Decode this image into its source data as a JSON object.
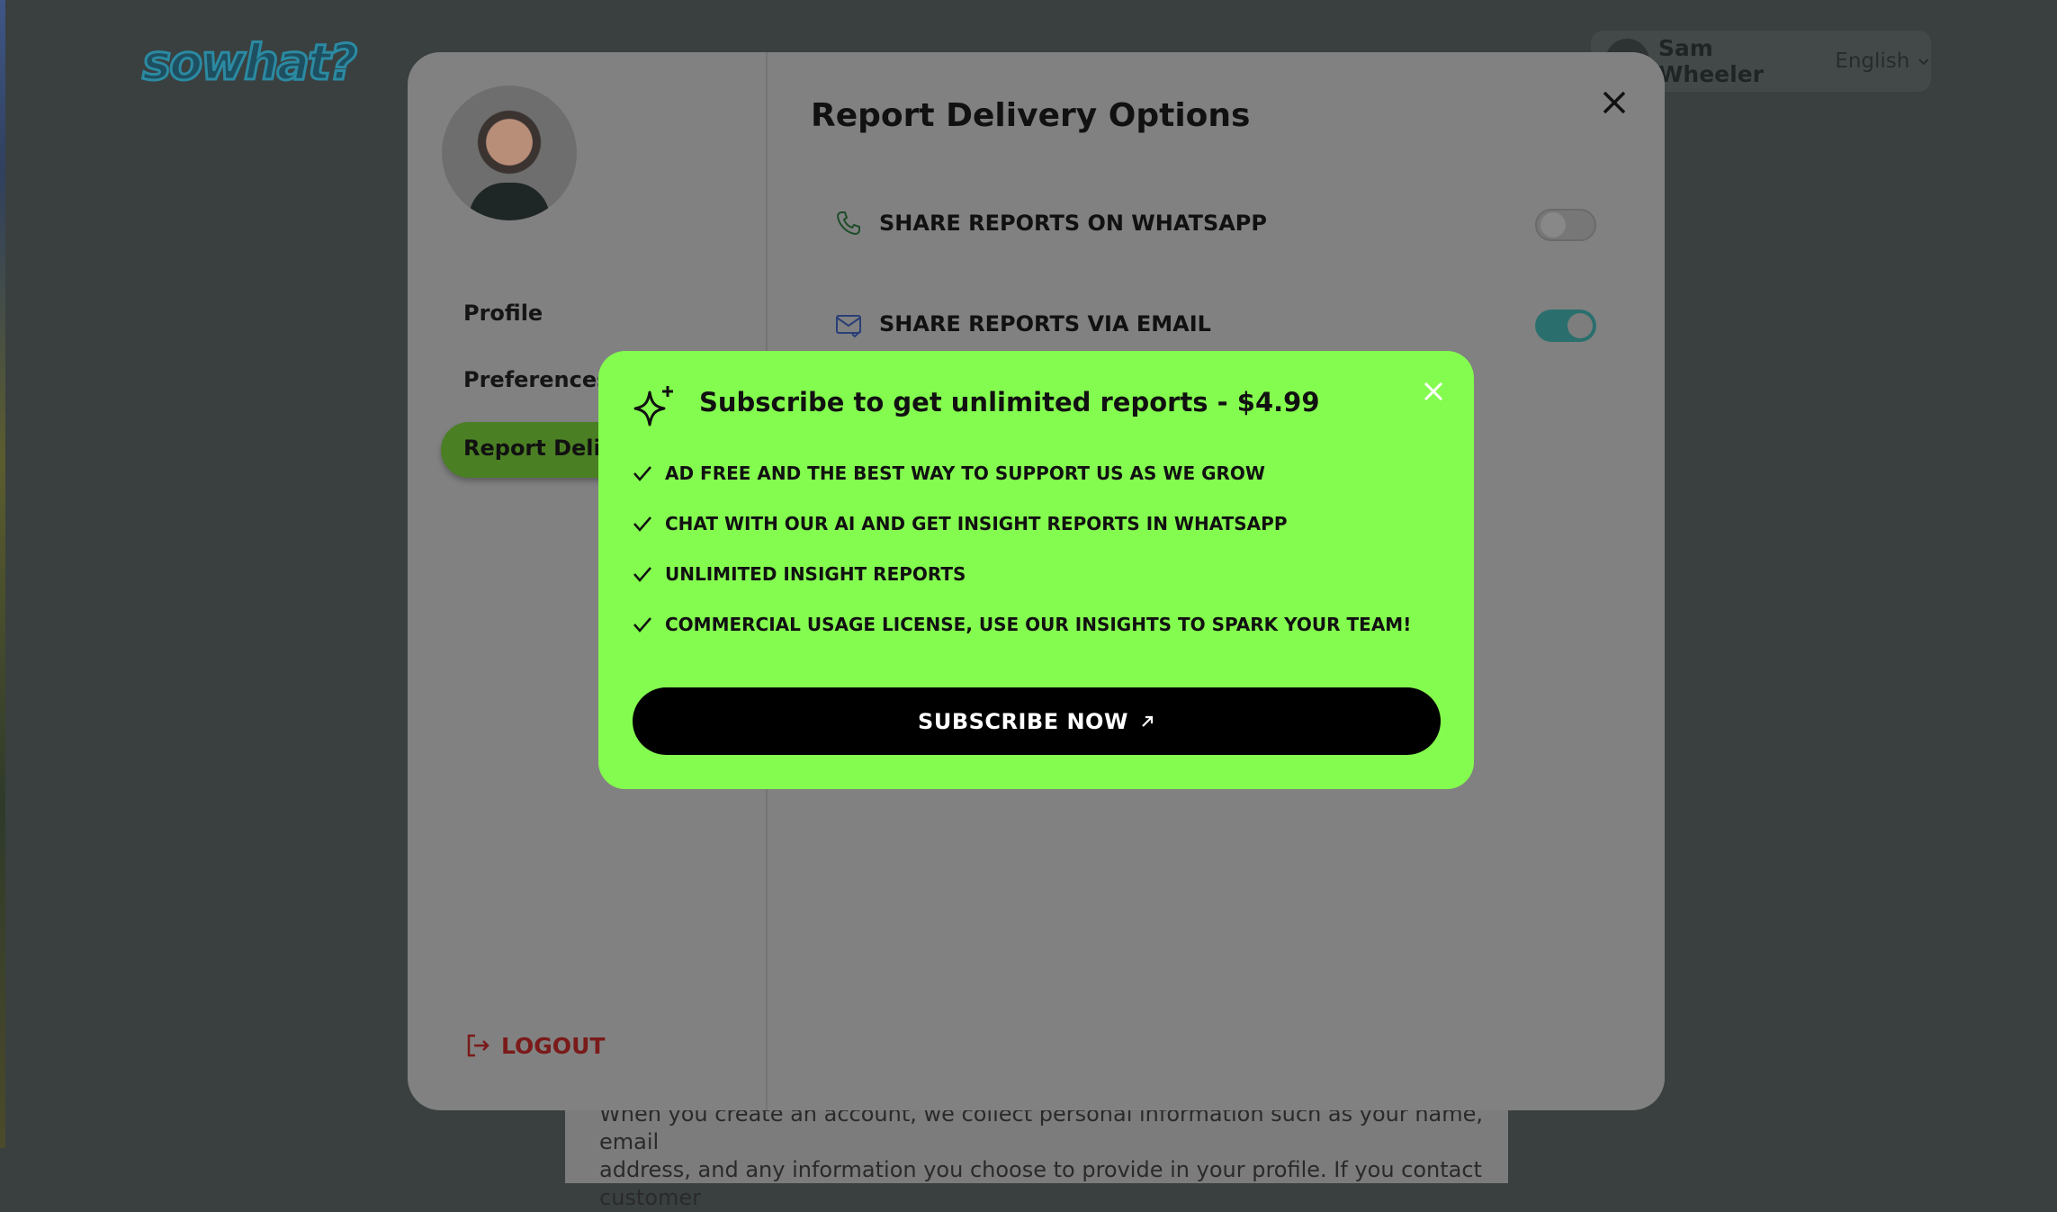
{
  "brand": {
    "logo_text": "sowhat?"
  },
  "topbar": {
    "user_name": "Sam Wheeler",
    "language": "English"
  },
  "background_text": {
    "line1": "When you create an account, we collect personal information such as your name, email",
    "line2": "address, and any information you choose to provide in your profile. If you contact customer"
  },
  "sidebar": {
    "items": [
      {
        "label": "Profile"
      },
      {
        "label": "Preferences"
      },
      {
        "label": "Report Delivery"
      }
    ],
    "active_index": 2,
    "logout_label": "LOGOUT"
  },
  "main": {
    "title": "Report Delivery Options",
    "options": [
      {
        "icon": "phone-icon",
        "label": "SHARE REPORTS ON WHATSAPP",
        "enabled": false
      },
      {
        "icon": "mail-check-icon",
        "label": "SHARE REPORTS VIA EMAIL",
        "enabled": true
      }
    ]
  },
  "subscribe_popup": {
    "title": "Subscribe to get unlimited reports - $4.99",
    "features": [
      "AD FREE AND THE BEST WAY TO SUPPORT US AS WE GROW",
      "CHAT WITH OUR AI AND GET INSIGHT REPORTS IN WHATSAPP",
      "UNLIMITED INSIGHT REPORTS",
      "COMMERCIAL USAGE LICENSE, USE OUR INSIGHTS TO SPARK YOUR TEAM!"
    ],
    "cta_label": "SUBSCRIBE NOW"
  },
  "colors": {
    "popup_bg": "#84fc4f",
    "active_nav": "#4b7f24",
    "toggle_on": "#2a6f6d",
    "logout": "#7a1a1a"
  }
}
